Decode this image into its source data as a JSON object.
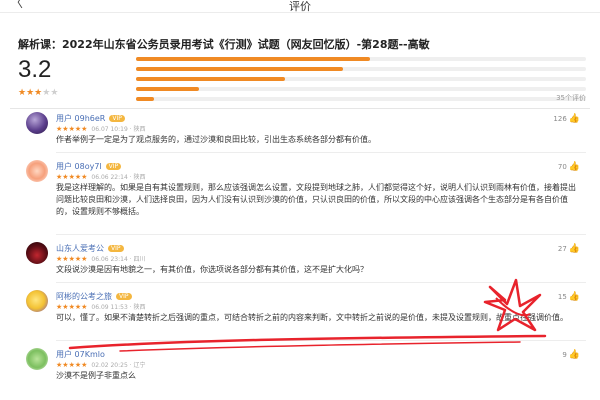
{
  "header": {
    "back_icon": "chevron-left-icon",
    "back_glyph": "〈",
    "title": "评价"
  },
  "summary": {
    "title": "解析课：2022年山东省公务员录用考试《行测》试题（网友回忆版）-第28题--高敏",
    "score": "3.2",
    "stars": 3,
    "max_stars": 5,
    "rating_distribution": [
      0.52,
      0.46,
      0.33,
      0.14,
      0.04
    ],
    "rating_count": "35个评价"
  },
  "colors": {
    "accent": "#f08a24",
    "username": "#4a6fb5",
    "annotation": "#e8232c"
  },
  "comments": [
    {
      "user": "用户 09h6eR",
      "badge": "VIP",
      "stars": 5,
      "meta": "06.07 10:19 · 陕西",
      "text": "作者举例子一定是为了观点服务的，通过沙漠和良田比较，引出生态系统各部分都有价值。",
      "likes": "126",
      "avatar": "purple"
    },
    {
      "user": "用户 08oy7l",
      "badge": "VIP",
      "stars": 5,
      "meta": "06.06 22:14 · 陕西",
      "text": "我是这样理解的。如果是自有其设置规则，那么应该强调怎么设置，文段提到地球之肺，人们都觉得这个好，说明人们认识到雨林有价值，接着提出问题比较良田和沙漠，人们选择良田，因为人们没有认识到沙漠的价值，只认识良田的价值，所以文段的中心应该强调各个生态部分是有各自价值的，设置规则不够概括。",
      "likes": "70",
      "avatar": "peach"
    },
    {
      "user": "山东人爱考公",
      "badge": "VIP",
      "stars": 5,
      "meta": "06.06 23:14 · 四川",
      "text": "文段说沙漠是因有地貌之一，有其价值，你选项说各部分都有其价值，这不是扩大化吗？",
      "likes": "27",
      "avatar": "dark"
    },
    {
      "user": "阿彬的公考之旅",
      "badge": "VIP",
      "stars": 5,
      "meta": "06.09 11:53 · 陕西",
      "text": "可以，懂了。如果不清楚转折之后强调的重点，可结合转折之前的内容来判断，文中转折之前说的是价值，未提及设置规则，故重点在强调价值。",
      "likes": "15",
      "avatar": "yellow"
    },
    {
      "user": "用户 07Kmlo",
      "badge": "",
      "stars": 5,
      "meta": "02.02 20:25 · 辽宁",
      "text": "沙漠不是例子非重点么",
      "likes": "9",
      "avatar": "green"
    }
  ]
}
